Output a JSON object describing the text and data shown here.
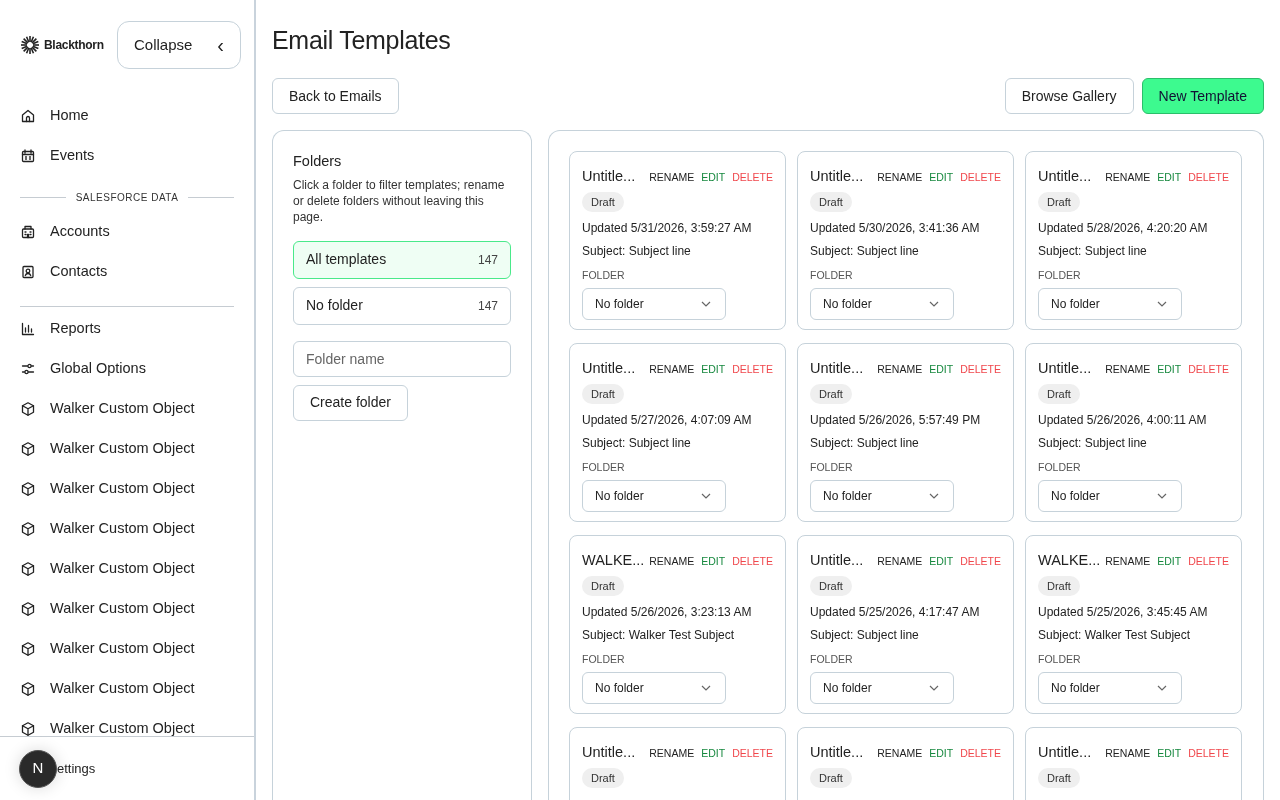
{
  "brand": {
    "name": "Blackthorn"
  },
  "collapse_button": {
    "label": "Collapse",
    "chevron": "‹"
  },
  "sidebar": {
    "items": [
      {
        "label": "Home",
        "kind": "home"
      },
      {
        "label": "Events",
        "kind": "calendar"
      },
      {
        "label": "SALESFORCE DATA",
        "kind": "section"
      },
      {
        "label": "Accounts",
        "kind": "building"
      },
      {
        "label": "Contacts",
        "kind": "contact"
      },
      {
        "kind": "divider"
      },
      {
        "label": "Reports",
        "kind": "chart"
      },
      {
        "label": "Global Options",
        "kind": "options"
      },
      {
        "label": "Walker Custom Object",
        "kind": "cube"
      },
      {
        "label": "Walker Custom Object",
        "kind": "cube"
      },
      {
        "label": "Walker Custom Object",
        "kind": "cube"
      },
      {
        "label": "Walker Custom Object",
        "kind": "cube"
      },
      {
        "label": "Walker Custom Object",
        "kind": "cube"
      },
      {
        "label": "Walker Custom Object",
        "kind": "cube"
      },
      {
        "label": "Walker Custom Object",
        "kind": "cube"
      },
      {
        "label": "Walker Custom Object",
        "kind": "cube"
      },
      {
        "label": "Walker Custom Object",
        "kind": "cube"
      }
    ],
    "footer": {
      "label": "ettings",
      "avatar": "N"
    }
  },
  "page": {
    "title": "Email Templates"
  },
  "toolbar": {
    "back": "Back to Emails",
    "browse": "Browse Gallery",
    "new": "New Template"
  },
  "folders": {
    "title": "Folders",
    "description": "Click a folder to filter templates; rename or delete folders without leaving this page.",
    "items": [
      {
        "label": "All templates",
        "count": "147",
        "selected": true
      },
      {
        "label": "No folder",
        "count": "147",
        "selected": false
      }
    ],
    "placeholder": "Folder name",
    "create": "Create folder"
  },
  "templates": [
    {
      "title": "Untitle...",
      "actions": [
        "RENAME",
        "EDIT",
        "DELETE"
      ],
      "status": "Draft",
      "updated": "Updated 5/31/2026, 3:59:27 AM",
      "subject": "Subject: Subject line",
      "folder_label": "FOLDER",
      "folder": "No folder"
    },
    {
      "title": "Untitle...",
      "actions": [
        "RENAME",
        "EDIT",
        "DELETE"
      ],
      "status": "Draft",
      "updated": "Updated 5/30/2026, 3:41:36 AM",
      "subject": "Subject: Subject line",
      "folder_label": "FOLDER",
      "folder": "No folder"
    },
    {
      "title": "Untitle...",
      "actions": [
        "RENAME",
        "EDIT",
        "DELETE"
      ],
      "status": "Draft",
      "updated": "Updated 5/28/2026, 4:20:20 AM",
      "subject": "Subject: Subject line",
      "folder_label": "FOLDER",
      "folder": "No folder"
    },
    {
      "title": "Untitle...",
      "actions": [
        "RENAME",
        "EDIT",
        "DELETE"
      ],
      "status": "Draft",
      "updated": "Updated 5/27/2026, 4:07:09 AM",
      "subject": "Subject: Subject line",
      "folder_label": "FOLDER",
      "folder": "No folder"
    },
    {
      "title": "Untitle...",
      "actions": [
        "RENAME",
        "EDIT",
        "DELETE"
      ],
      "status": "Draft",
      "updated": "Updated 5/26/2026, 5:57:49 PM",
      "subject": "Subject: Subject line",
      "folder_label": "FOLDER",
      "folder": "No folder"
    },
    {
      "title": "Untitle...",
      "actions": [
        "RENAME",
        "EDIT",
        "DELETE"
      ],
      "status": "Draft",
      "updated": "Updated 5/26/2026, 4:00:11 AM",
      "subject": "Subject: Subject line",
      "folder_label": "FOLDER",
      "folder": "No folder"
    },
    {
      "title": "WALKE...",
      "actions": [
        "RENAME",
        "EDIT",
        "DELETE"
      ],
      "status": "Draft",
      "updated": "Updated 5/26/2026, 3:23:13 AM",
      "subject": "Subject: Walker Test Subject",
      "folder_label": "FOLDER",
      "folder": "No folder"
    },
    {
      "title": "Untitle...",
      "actions": [
        "RENAME",
        "EDIT",
        "DELETE"
      ],
      "status": "Draft",
      "updated": "Updated 5/25/2026, 4:17:47 AM",
      "subject": "Subject: Subject line",
      "folder_label": "FOLDER",
      "folder": "No folder"
    },
    {
      "title": "WALKE...",
      "actions": [
        "RENAME",
        "EDIT",
        "DELETE"
      ],
      "status": "Draft",
      "updated": "Updated 5/25/2026, 3:45:45 AM",
      "subject": "Subject: Walker Test Subject",
      "folder_label": "FOLDER",
      "folder": "No folder"
    },
    {
      "title": "Untitle...",
      "actions": [
        "RENAME",
        "EDIT",
        "DELETE"
      ],
      "status": "Draft"
    },
    {
      "title": "Untitle...",
      "actions": [
        "RENAME",
        "EDIT",
        "DELETE"
      ],
      "status": "Draft"
    },
    {
      "title": "Untitle...",
      "actions": [
        "RENAME",
        "EDIT",
        "DELETE"
      ],
      "status": "Draft"
    }
  ]
}
